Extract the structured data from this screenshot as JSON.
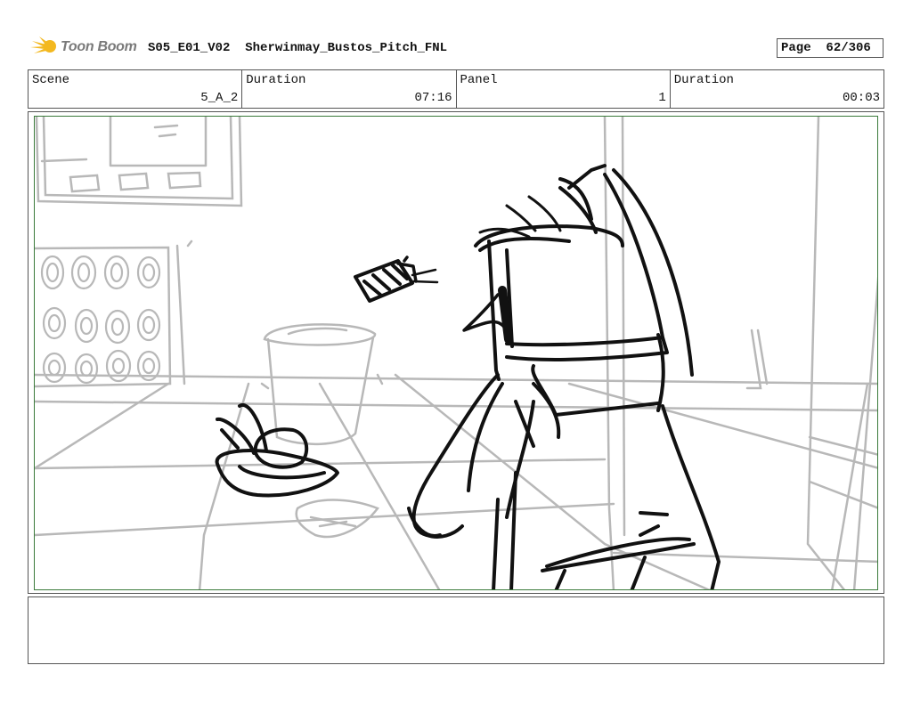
{
  "header": {
    "brand_text": "Toon Boom",
    "episode": "S05_E01_V02",
    "project": "Sherwinmay_Bustos_Pitch_FNL",
    "page_label": "Page",
    "page_value": "62/306"
  },
  "info": {
    "scene_label": "Scene",
    "scene_value": "5_A_2",
    "duration_label": "Duration",
    "duration_value": "07:16",
    "panel_label": "Panel",
    "panel_value": "1",
    "panel_duration_label": "Duration",
    "panel_duration_value": "00:03"
  },
  "colors": {
    "sketch_dark": "#111111",
    "sketch_light": "#b5b5b5",
    "panel_border": "#3a7a3a",
    "logo_yellow": "#f3b81f"
  }
}
